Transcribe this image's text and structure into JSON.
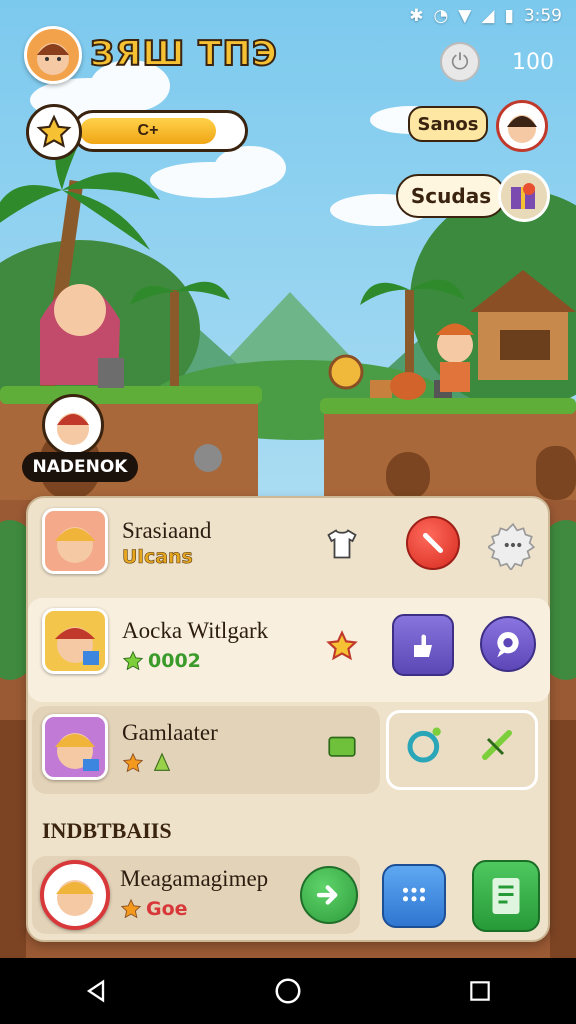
{
  "status_bar": {
    "time": "3:59"
  },
  "hud": {
    "title": "ЗЯШ ТПЭ",
    "coins": "100",
    "xp_label": "C+",
    "xp_fraction": 0.85
  },
  "map": {
    "player_name": "NADENOK",
    "bubble_1": "Sanos",
    "bubble_2": "Scudas"
  },
  "list": {
    "section_label": "INDBTBAIIS",
    "rows": [
      {
        "name": "Srasiaand",
        "sub": "Ulcans"
      },
      {
        "name": "Aocka Witlgark",
        "sub": "0002"
      },
      {
        "name": "Gamlaater",
        "sub": ""
      },
      {
        "name": "Meagamagimep",
        "sub": "Goe"
      }
    ]
  },
  "colors": {
    "sky": "#a9dcf2",
    "panel": "#efe2cb",
    "accent_gold": "#f6c233",
    "red_button": "#e0322b",
    "purple_button": "#6f5cc7",
    "green_button": "#36b34a",
    "blue_button": "#3d86e0"
  },
  "icons": {
    "star": "star-icon",
    "shirt": "shirt-icon",
    "gear": "gear-icon",
    "chat": "chat-icon",
    "arrow": "arrow-right-icon"
  }
}
